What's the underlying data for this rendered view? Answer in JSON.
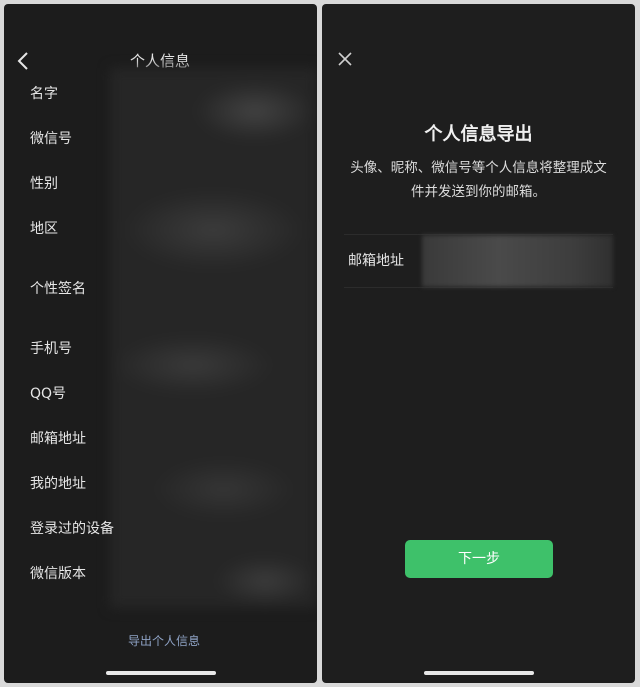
{
  "left_screen": {
    "title": "个人信息",
    "rows": [
      {
        "label": "名字"
      },
      {
        "label": "微信号"
      },
      {
        "label": "性别"
      },
      {
        "label": "地区"
      },
      {
        "label": "个性签名"
      },
      {
        "label": "手机号"
      },
      {
        "label": "QQ号"
      },
      {
        "label": "邮箱地址"
      },
      {
        "label": "我的地址"
      },
      {
        "label": "登录过的设备"
      },
      {
        "label": "微信版本"
      }
    ],
    "export_link": "导出个人信息"
  },
  "right_screen": {
    "title": "个人信息导出",
    "description": "头像、昵称、微信号等个人信息将整理成文件并发送到你的邮箱。",
    "email_label": "邮箱地址",
    "email_value": "",
    "next_button": "下一步"
  },
  "colors": {
    "background": "#1c1c1c",
    "accent_green": "#3ec16a",
    "link_blue": "#8fa3c6"
  },
  "icons": {
    "back": "chevron-left-icon",
    "close": "close-icon"
  }
}
